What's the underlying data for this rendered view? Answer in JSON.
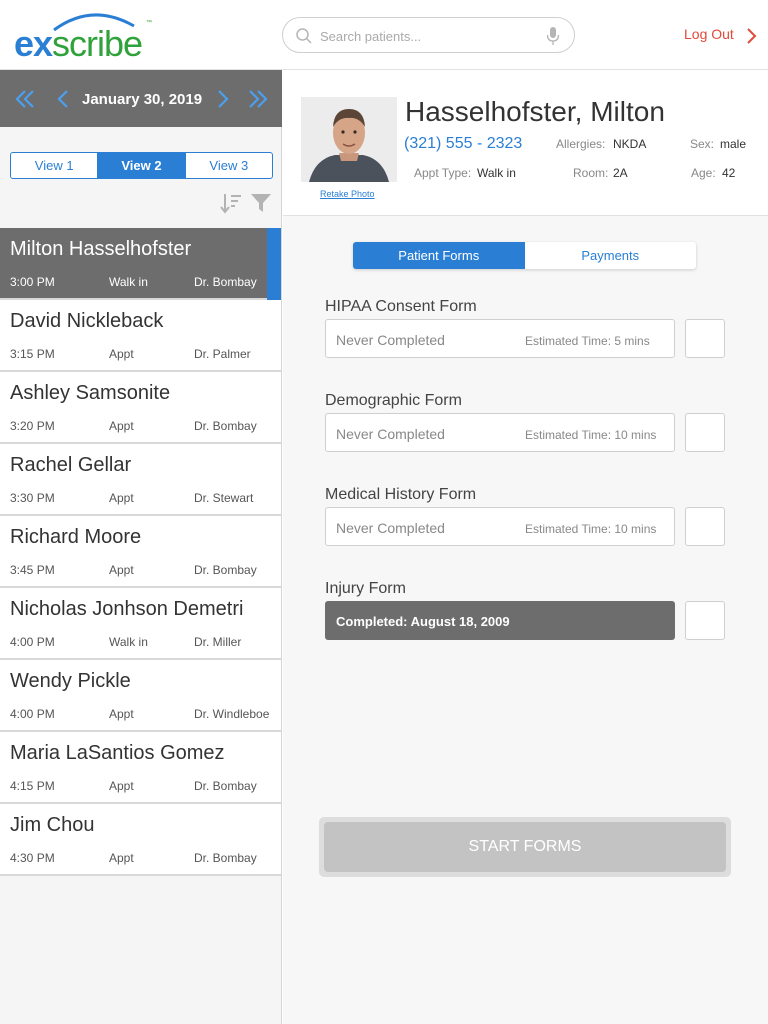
{
  "header": {
    "logo": {
      "ex": "ex",
      "scribe": "scribe",
      "tm": "™"
    },
    "search_placeholder": "Search patients...",
    "logout_label": "Log Out"
  },
  "schedule": {
    "date": "January 30, 2019",
    "views": [
      "View 1",
      "View 2",
      "View 3"
    ],
    "active_view": "View 2",
    "patients": [
      {
        "name": "Milton Hasselhofster",
        "time": "3:00 PM",
        "type": "Walk in",
        "doctor": "Dr. Bombay"
      },
      {
        "name": "David Nickleback",
        "time": "3:15 PM",
        "type": "Appt",
        "doctor": "Dr. Palmer"
      },
      {
        "name": "Ashley Samsonite",
        "time": "3:20 PM",
        "type": "Appt",
        "doctor": "Dr. Bombay"
      },
      {
        "name": "Rachel Gellar",
        "time": "3:30 PM",
        "type": "Appt",
        "doctor": "Dr. Stewart"
      },
      {
        "name": "Richard Moore",
        "time": "3:45 PM",
        "type": "Appt",
        "doctor": "Dr. Bombay"
      },
      {
        "name": "Nicholas Jonhson Demetri",
        "time": "4:00 PM",
        "type": "Walk in",
        "doctor": "Dr. Miller"
      },
      {
        "name": "Wendy Pickle",
        "time": "4:00 PM",
        "type": "Appt",
        "doctor": "Dr. Windleboe"
      },
      {
        "name": "Maria LaSantios Gomez",
        "time": "4:15 PM",
        "type": "Appt",
        "doctor": "Dr. Bombay"
      },
      {
        "name": "Jim Chou",
        "time": "4:30 PM",
        "type": "Appt",
        "doctor": "Dr. Bombay"
      }
    ],
    "selected_index": 0
  },
  "patient": {
    "name": "Hasselhofster, Milton",
    "phone": "(321) 555 - 2323",
    "retake_label": "Retake Photo",
    "allergies_label": "Allergies:",
    "allergies": "NKDA",
    "sex_label": "Sex:",
    "sex": "male",
    "appt_type_label": "Appt Type:",
    "appt_type": "Walk in",
    "room_label": "Room:",
    "room": "2A",
    "age_label": "Age:",
    "age": "42"
  },
  "tabs": [
    "Patient Forms",
    "Payments"
  ],
  "active_tab": "Patient Forms",
  "forms": [
    {
      "title": "HIPAA Consent Form",
      "status": "Never Completed",
      "estimate": "Estimated Time: 5 mins",
      "completed": false
    },
    {
      "title": "Demographic Form",
      "status": "Never Completed",
      "estimate": "Estimated Time: 10 mins",
      "completed": false
    },
    {
      "title": "Medical History Form",
      "status": "Never Completed",
      "estimate": "Estimated Time: 10 mins",
      "completed": false
    },
    {
      "title": "Injury Form",
      "status": "Completed: August 18, 2009",
      "estimate": "",
      "completed": true
    }
  ],
  "start_label": "START FORMS",
  "colors": {
    "accent": "#2a7fd4",
    "brand_green": "#2fa23b",
    "logout": "#e04a3a",
    "selected_row": "#6d6d6d"
  },
  "icons": {
    "search": "search-icon",
    "mic": "microphone-icon",
    "logout": "chevron-right-icon",
    "date_first": "double-chevron-left-icon",
    "date_prev": "chevron-left-icon",
    "date_next": "chevron-right-icon",
    "date_last": "double-chevron-right-icon",
    "sort": "sort-icon",
    "filter": "filter-icon"
  }
}
